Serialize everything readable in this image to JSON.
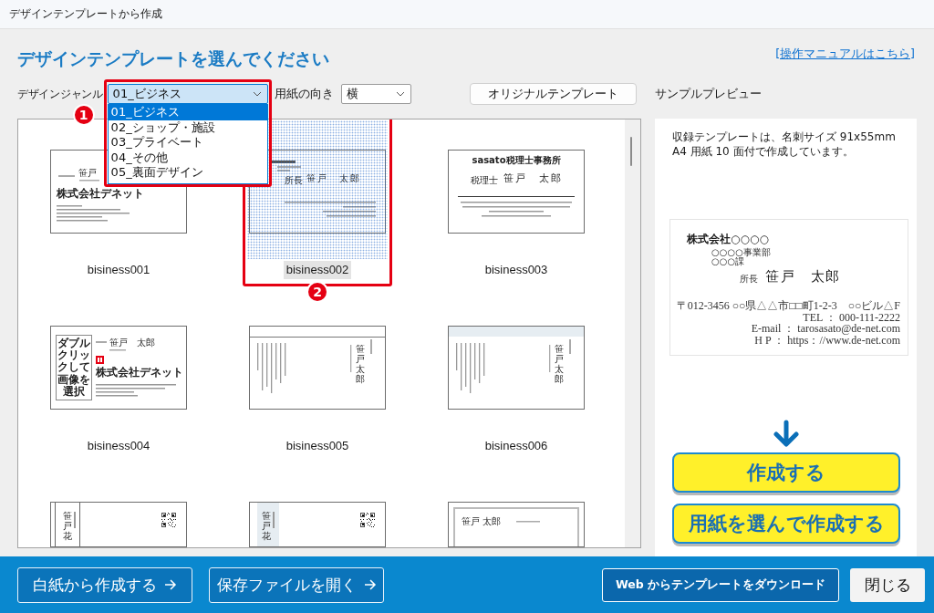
{
  "window": {
    "title": "デザインテンプレートから作成"
  },
  "heading": "デザインテンプレートを選んでください",
  "manual_link": "[操作マニュアルはこちら]",
  "genre": {
    "label": "デザインジャンル",
    "value": "01_ビジネス",
    "expanded": true,
    "annotation": "1",
    "options": [
      {
        "label": "01_ビジネス",
        "selected": true
      },
      {
        "label": "02_ショップ・施設",
        "selected": false
      },
      {
        "label": "03_プライベート",
        "selected": false
      },
      {
        "label": "04_その他",
        "selected": false
      },
      {
        "label": "05_裏面デザイン",
        "selected": false
      }
    ]
  },
  "orientation": {
    "label": "用紙の向き",
    "value": "横"
  },
  "original_button": "オリジナルテンプレート",
  "templates": [
    {
      "label": "bisiness001",
      "selected": false,
      "kind": "left",
      "name": "笹戸",
      "company": "株式会社デネット"
    },
    {
      "label": "bisiness002",
      "selected": true,
      "annotation": "2",
      "kind": "boxed",
      "title": "所長",
      "name": "笹戸　太郎"
    },
    {
      "label": "bisiness003",
      "selected": false,
      "kind": "office",
      "office": "sasato税理士事務所",
      "title": "税理士",
      "name": "笹戸　太郎"
    },
    {
      "label": "bisiness004",
      "selected": false,
      "kind": "photo",
      "photo_hint": "ダブルクリックして画像を選択",
      "name": "笹戸　太郎",
      "company": "株式会社デネット"
    },
    {
      "label": "bisiness005",
      "selected": false,
      "kind": "vertical-line",
      "name": "笹戸太郎"
    },
    {
      "label": "bisiness006",
      "selected": false,
      "kind": "vertical-band",
      "name": "笹戸太郎"
    },
    {
      "selected": false,
      "kind": "qr-line",
      "name": "笹戸花"
    },
    {
      "selected": false,
      "kind": "qr-band",
      "name": "笹戸花"
    },
    {
      "selected": false,
      "kind": "framed",
      "name": "笹戸 太郎"
    }
  ],
  "preview": {
    "label": "サンプルプレビュー",
    "note": "収録テンプレートは、名刺サイズ 91x55mm\nA4 用紙 10 面付で作成しています。",
    "card": {
      "company": "株式会社○○○○",
      "departments": [
        "○○○○事業部",
        "○○○課"
      ],
      "title": "所長",
      "name": "笹戸　太郎",
      "address": [
        "〒012-3456 ○○県△△市□□町1-2-3　○○ビル△F",
        "TEL ： 000-111-2222",
        "E-mail ： tarosasato@de-net.com",
        "H P ： https：//www.de-net.com"
      ]
    },
    "buttons": [
      "作成する",
      "用紙を選んで作成する"
    ]
  },
  "footer": {
    "buttons": [
      {
        "label": "白紙から作成する",
        "kind": "arrow"
      },
      {
        "label": "保存ファイルを開く",
        "kind": "arrow"
      },
      {
        "label": "Web からテンプレートをダウンロード",
        "kind": "web"
      },
      {
        "label": "閉じる",
        "kind": "close"
      }
    ]
  }
}
